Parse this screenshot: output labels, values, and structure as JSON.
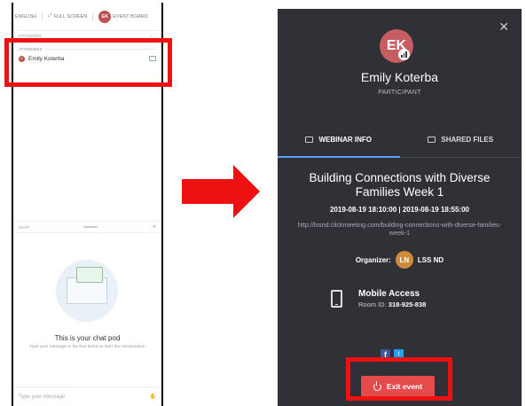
{
  "left_panel": {
    "nav": {
      "language": "ENGLISH",
      "fullscreen": "FULL SCREEN",
      "avatar_initials": "EK",
      "event_board": "EVENT BOARD"
    },
    "attendees_label": "ATTENDEES",
    "attendee_section_label": "ATTENDEES",
    "attendee_initials": "E",
    "attendee_name": "Emily Koterba",
    "chat_label": "CHAT",
    "chat_title": "This is your chat pod",
    "chat_sub": "Type your message in the box below to start the conversation",
    "input_placeholder": "Type your message"
  },
  "right_panel": {
    "avatar_initials": "EK",
    "name": "Emily Koterba",
    "role": "PARTICIPANT",
    "tabs": [
      {
        "label": "WEBINAR INFO",
        "active": true
      },
      {
        "label": "SHARED FILES",
        "active": false
      }
    ],
    "event_title": "Building Connections with Diverse Families Week 1",
    "event_time": "2019-08-19 18:10:00 | 2019-08-19 18:55:00",
    "event_url": "http://lssnd.clickmeeting.com/building-connections-with-diverse-families-week-1",
    "organizer_label": "Organizer:",
    "organizer_initials": "LN",
    "organizer_name": "LSS ND",
    "mobile_title": "Mobile Access",
    "room_id_label": "Room ID:",
    "room_id": "318-925-838",
    "exit_label": "Exit event"
  },
  "colors": {
    "highlight": "#ee1111",
    "panel_bg": "#2f3136",
    "exit_button": "#e54b4b",
    "avatar": "#c65d61",
    "tab_active_underline": "#5ca0ff"
  }
}
